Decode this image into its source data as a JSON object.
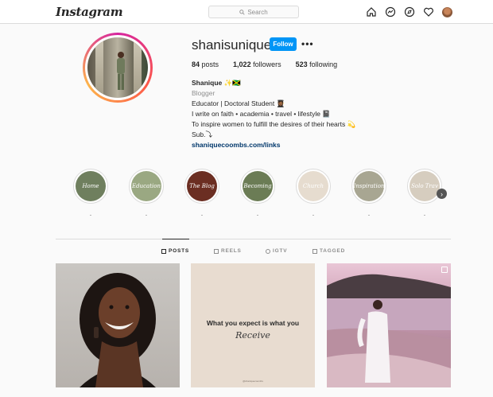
{
  "header": {
    "logo": "Instagram",
    "search_placeholder": "Search",
    "nav_icons": [
      "home-icon",
      "messenger-icon",
      "explore-icon",
      "heart-icon",
      "avatar"
    ]
  },
  "profile": {
    "username": "shanisunique",
    "follow_label": "Follow",
    "more_label": "•••",
    "stats": {
      "posts_count": "84",
      "posts_label": "posts",
      "followers_count": "1,022",
      "followers_label": "followers",
      "following_count": "523",
      "following_label": "following"
    },
    "bio": {
      "name": "Shanique ✨🇯🇲",
      "category": "Blogger",
      "line1": "Educator | Doctoral Student 👩🏾‍🎓",
      "line2": "I write on faith • academia • travel • lifestyle 📓",
      "line3": "To inspire women to fulfill the desires of their hearts 💫",
      "line4": "Sub.⤵",
      "link": "shaniquecoombs.com/links"
    }
  },
  "highlights": [
    {
      "label": "Home",
      "caption": ".",
      "color": "#6f7f5e"
    },
    {
      "label": "Education",
      "caption": ".",
      "color": "#9aa882"
    },
    {
      "label": "The Blog",
      "caption": ".",
      "color": "#6b2e22"
    },
    {
      "label": "Becoming",
      "caption": ".",
      "color": "#6b7c55"
    },
    {
      "label": "Church",
      "caption": ".",
      "color": "#e6dccf"
    },
    {
      "label": "Inspiration",
      "caption": ".",
      "color": "#a8a692"
    },
    {
      "label": "Solo Trav",
      "caption": ".",
      "color": "#d6cdbf"
    }
  ],
  "tabs": [
    {
      "label": "POSTS",
      "icon": "grid-icon",
      "active": true
    },
    {
      "label": "REELS",
      "icon": "reels-icon",
      "active": false
    },
    {
      "label": "IGTV",
      "icon": "igtv-icon",
      "active": false
    },
    {
      "label": "TAGGED",
      "icon": "tagged-icon",
      "active": false
    }
  ],
  "posts": [
    {
      "type": "portrait-photo"
    },
    {
      "type": "quote",
      "text": "What you expect is what you",
      "script": "Receive",
      "footer": "@shaniquecoombs"
    },
    {
      "type": "beach-photo"
    }
  ],
  "colors": {
    "accent": "#0095f6",
    "link": "#00376b",
    "text": "#262626",
    "muted": "#8e8e8e"
  }
}
